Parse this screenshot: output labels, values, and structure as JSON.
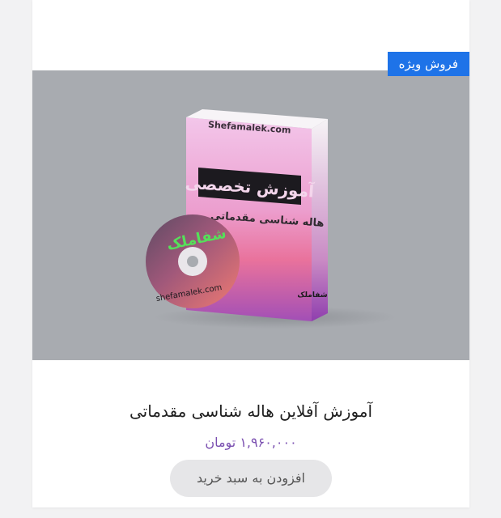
{
  "product": {
    "badge": "فروش ویژه",
    "title": "آموزش آفلاین هاله شناسی مقدماتی",
    "price": "۱,۹۶۰,۰۰۰ تومان",
    "add_to_cart_label": "افزودن به سبد خرید"
  },
  "image": {
    "box_site": "Shefamalek.com",
    "box_heading": "آموزش تخصصی",
    "box_subheading": "هاله شناسی مقدماتی",
    "box_side_brand": "شفاملک",
    "disc_brand": "شفاملک",
    "disc_site": "shefamalek.com"
  },
  "colors": {
    "badge": "#1e73e8",
    "price": "#7a4fb0",
    "button_bg": "#e6e6e8",
    "image_bg": "#a8abb0"
  }
}
